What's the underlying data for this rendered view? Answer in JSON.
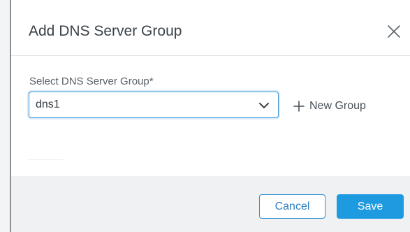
{
  "dialog": {
    "title": "Add DNS Server Group",
    "close_icon": "close-icon"
  },
  "form": {
    "label": "Select DNS Server Group*",
    "selected_value": "dns1",
    "dropdown_icon": "chevron-down-icon",
    "new_group_icon": "plus-icon",
    "new_group_label": "New Group"
  },
  "footer": {
    "cancel_label": "Cancel",
    "save_label": "Save"
  },
  "colors": {
    "accent": "#1e9ae0",
    "focus_border": "#3a95d8",
    "title_text": "#39424a",
    "footer_bg": "#f0f1f2"
  }
}
